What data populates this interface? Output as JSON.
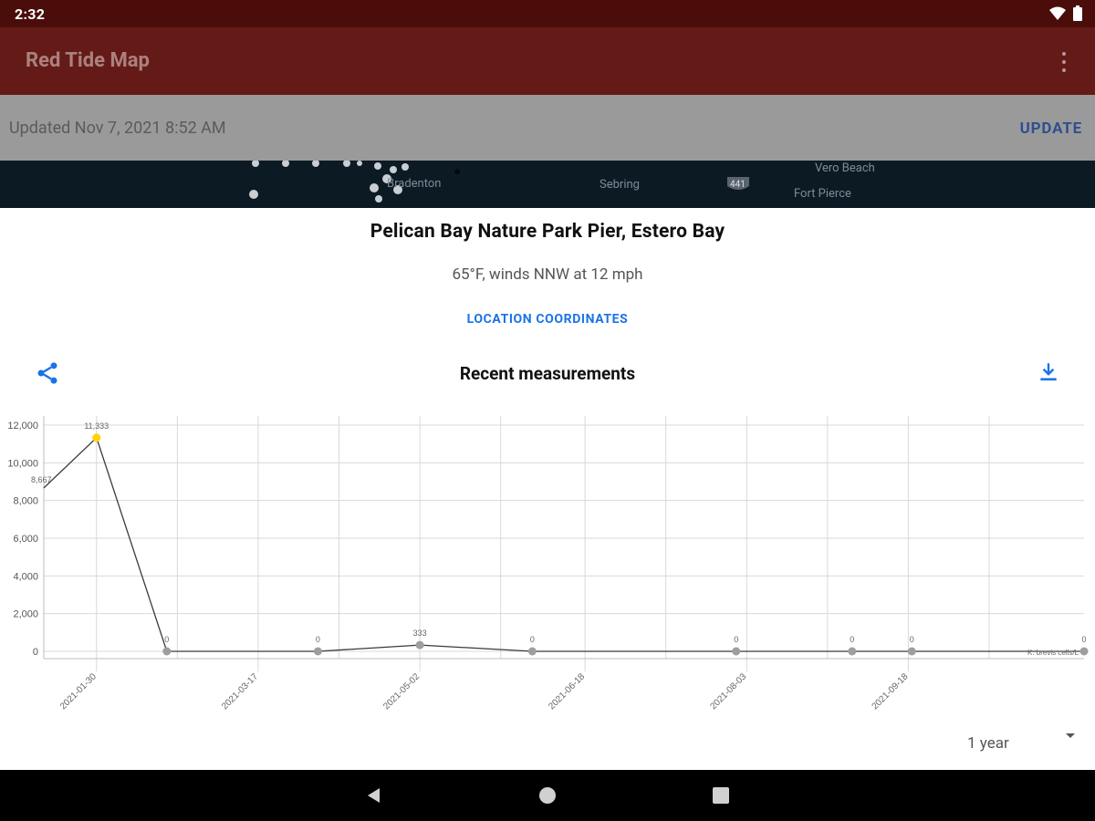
{
  "status_bar": {
    "time": "2:32",
    "icons": [
      "wifi-icon",
      "battery-icon"
    ]
  },
  "app_bar": {
    "title": "Red Tide Map",
    "overflow_icon": "more-vert-icon"
  },
  "banner": {
    "text": "Updated Nov 7, 2021 8:52 AM",
    "button_label": "UPDATE"
  },
  "map": {
    "labels": [
      "Bradenton",
      "Sebring",
      "Vero Beach",
      "Fort Pierce"
    ],
    "shield": "441"
  },
  "detail": {
    "station_name": "Pelican Bay Nature Park Pier, Estero Bay",
    "weather": "65°F, winds NNW at 12 mph",
    "coordinates_link": "LOCATION COORDINATES",
    "section_title": "Recent measurements",
    "share_icon": "share-icon",
    "download_icon": "download-icon"
  },
  "range_select": {
    "selected": "1 year"
  },
  "chart_data": {
    "type": "line",
    "series": [
      {
        "name": "K. brevis cells/L",
        "points": [
          {
            "x": "2021-01-15",
            "y": 8667,
            "label": "8,667"
          },
          {
            "x": "2021-01-30",
            "y": 11333,
            "label": "11,333"
          },
          {
            "x": "2021-02-19",
            "y": 0,
            "label": "0"
          },
          {
            "x": "2021-04-03",
            "y": 0,
            "label": "0"
          },
          {
            "x": "2021-05-02",
            "y": 333,
            "label": "333"
          },
          {
            "x": "2021-06-03",
            "y": 0,
            "label": "0"
          },
          {
            "x": "2021-07-31",
            "y": 0,
            "label": "0"
          },
          {
            "x": "2021-09-02",
            "y": 0,
            "label": "0"
          },
          {
            "x": "2021-09-19",
            "y": 0,
            "label": "0"
          },
          {
            "x": "2021-11-07",
            "y": 0,
            "label": "0"
          }
        ]
      }
    ],
    "yticks": [
      "12,000",
      "10,000",
      "8,000",
      "6,000",
      "4,000",
      "2,000",
      "0"
    ],
    "ytick_values": [
      12000,
      10000,
      8000,
      6000,
      4000,
      2000,
      0
    ],
    "xticks": [
      "2021-01-30",
      "2021-03-17",
      "2021-05-02",
      "2021-06-18",
      "2021-08-03",
      "2021-09-18"
    ],
    "ylim": [
      0,
      12000
    ],
    "unit_label": "K. brevis cells/L",
    "highlight_index": 1,
    "colors": {
      "line": "#3a3a3a",
      "point": "#9e9e9e",
      "highlight": "#ffd400",
      "grid": "#d9d9d9"
    }
  }
}
